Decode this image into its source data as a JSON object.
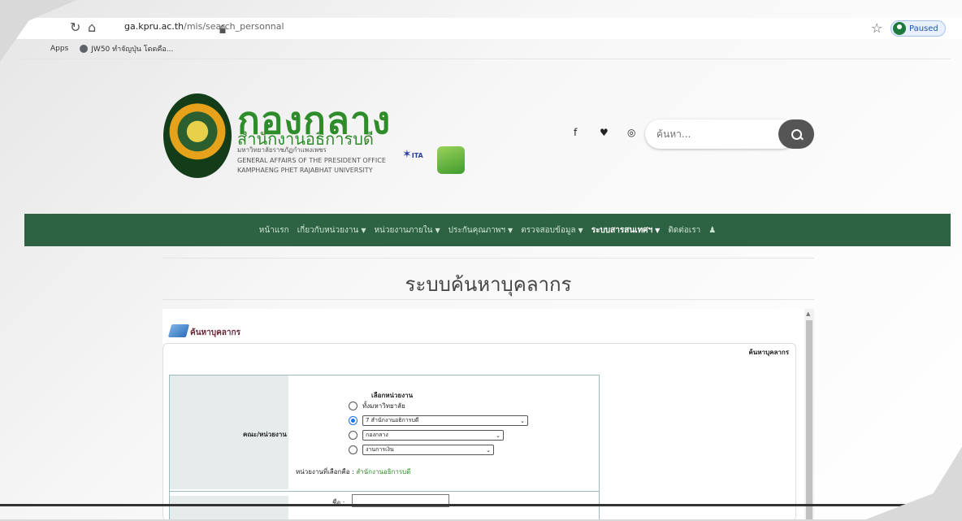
{
  "browser": {
    "url_host": "ga.kpru.ac.th",
    "url_path": "/mis/search_personnal",
    "profile_status": "Paused",
    "bookmarks": [
      "Apps",
      "JW50 ทำจัญปุ่น โดดคือ..."
    ]
  },
  "header": {
    "title": "กองกลาง",
    "subtitle": "สำนักงานอธิการบดี",
    "line1": "มหาวิทยาลัยราชภัฏกำแพงเพชร",
    "line2": "GENERAL AFFAIRS OF THE PRESIDENT OFFICE",
    "line3": "KAMPHAENG PHET RAJABHAT UNIVERSITY",
    "vita_label": "ITA",
    "search_placeholder": "ค้นหา..."
  },
  "nav": {
    "items": [
      {
        "label": "หน้าแรก",
        "caret": false
      },
      {
        "label": "เกี่ยวกับหน่วยงาน",
        "caret": true
      },
      {
        "label": "หน่วยงานภายใน",
        "caret": true
      },
      {
        "label": "ประกันคุณภาพฯ",
        "caret": true
      },
      {
        "label": "ตรวจสอบข้อมูล",
        "caret": true
      },
      {
        "label": "ระบบสารสนเทศฯ",
        "caret": true
      },
      {
        "label": "ติดต่อเรา",
        "caret": false
      }
    ]
  },
  "page": {
    "title": "ระบบค้นหาบุคลากร",
    "section_title": "ค้นหาบุคลากร",
    "panel_header": "ค้นหาบุคลากร",
    "faculty_label": "คณะ/หน่วยงาน",
    "choose_label": "เลือกหน่วยงาน",
    "option_all": "ทั้งมหาวิทยาลัย",
    "select1": "7 สำนักงานอธิการบดี",
    "select2": "กองกลาง",
    "select3": "งานการเงิน",
    "selected_prefix": "หน่วยงานที่เลือกคือ :",
    "selected_value": "สำนักงานอธิการบดี",
    "name_label": "ชื่อ :"
  }
}
